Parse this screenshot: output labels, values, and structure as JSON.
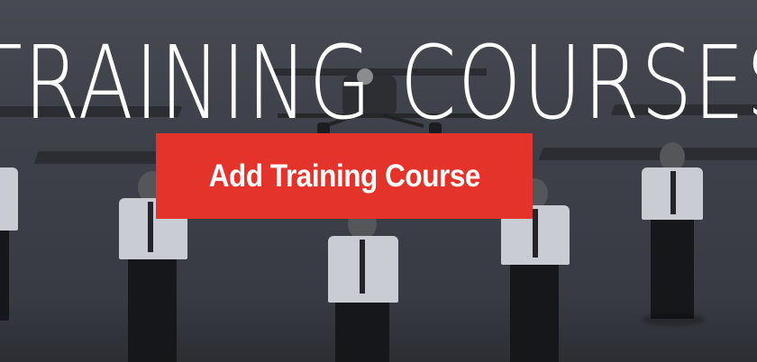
{
  "hero": {
    "headline": "TRAINING COURSES",
    "cta_label": "Add Training Course",
    "accent_color": "#e4332a",
    "background_image": "photo of uniformed pilots standing in front of a small aircraft on a tarmac"
  }
}
